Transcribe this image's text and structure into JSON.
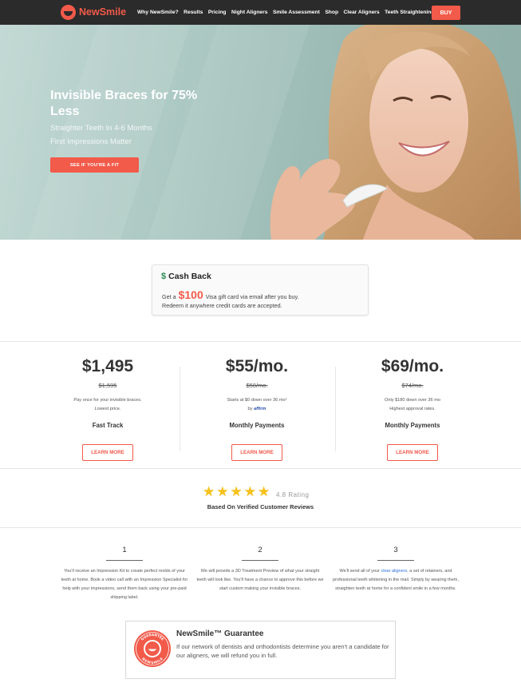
{
  "brand": {
    "name": "NewSmile",
    "accent": "#f25a4a",
    "nav_bg": "#2b2b2b"
  },
  "nav": {
    "links": [
      "Why NewSmile?",
      "Results",
      "Pricing",
      "Night Aligners",
      "Smile Assessment",
      "Shop",
      "Clear Aligners",
      "Teeth Straightening"
    ],
    "buy_label": "BUY"
  },
  "hero": {
    "title": "Invisible Braces for 75% Less",
    "sub1": "Straighter Teeth In 4-6 Months",
    "sub2": "First Impressions Matter",
    "cta": "SEE IF YOU'RE A FIT"
  },
  "cashback": {
    "icon": "dollar-icon",
    "title": "Cash Back",
    "line1_prefix": "Get a",
    "amount": "$100",
    "line1_suffix": "Visa gift card via email after you buy.",
    "line2": "Redeem it anywhere credit cards are accepted."
  },
  "plans": [
    {
      "price": "$1,495",
      "old_price": "$1,595",
      "desc1": "Pay once for your invisible braces.",
      "desc2": "Lowest price.",
      "name": "Fast Track",
      "button": "LEARN MORE"
    },
    {
      "price": "$55/mo.",
      "old_price": "$58/mo.",
      "desc1": "Starts at $0 down over 36 mo¹",
      "desc2_prefix": "by",
      "desc2_brand": "affirm",
      "name": "Monthly Payments",
      "button": "LEARN MORE"
    },
    {
      "price": "$69/mo.",
      "old_price": "$74/mo.",
      "desc1": "Only $180 down over 36 mo",
      "desc2": "Highest approval rates.",
      "name": "Monthly Payments",
      "button": "LEARN MORE"
    }
  ],
  "rating": {
    "stars": 5,
    "score_text": "4.8 Rating",
    "subtitle": "Based On Verified Customer Reviews"
  },
  "steps": [
    {
      "number": "1",
      "text": "You'll receive an Impression Kit to create perfect molds of your teeth at home. Book a video call with an Impression Specialist for help with your impressions, send them back using your pre-paid shipping label."
    },
    {
      "number": "2",
      "text": "We will provide a 3D Treatment Preview of what your straight teeth will look like. You'll have a chance to approve this before we start custom making your invisible braces."
    },
    {
      "number": "3",
      "text_before": "We'll send all of your",
      "link": "clear aligners",
      "text_after": ", a set of retainers, and professional teeth whitening in the mail. Simply by wearing them, straighten teeth at home for a confident smile in a few months."
    }
  ],
  "guarantee": {
    "title": "NewSmile™ Guarantee",
    "text": "If our network of dentists and orthodontists determine you aren't a candidate for our aligners, we will refund you in full.",
    "seal_top": "GUARANTEE",
    "seal_bottom": "NEWSMILE"
  }
}
